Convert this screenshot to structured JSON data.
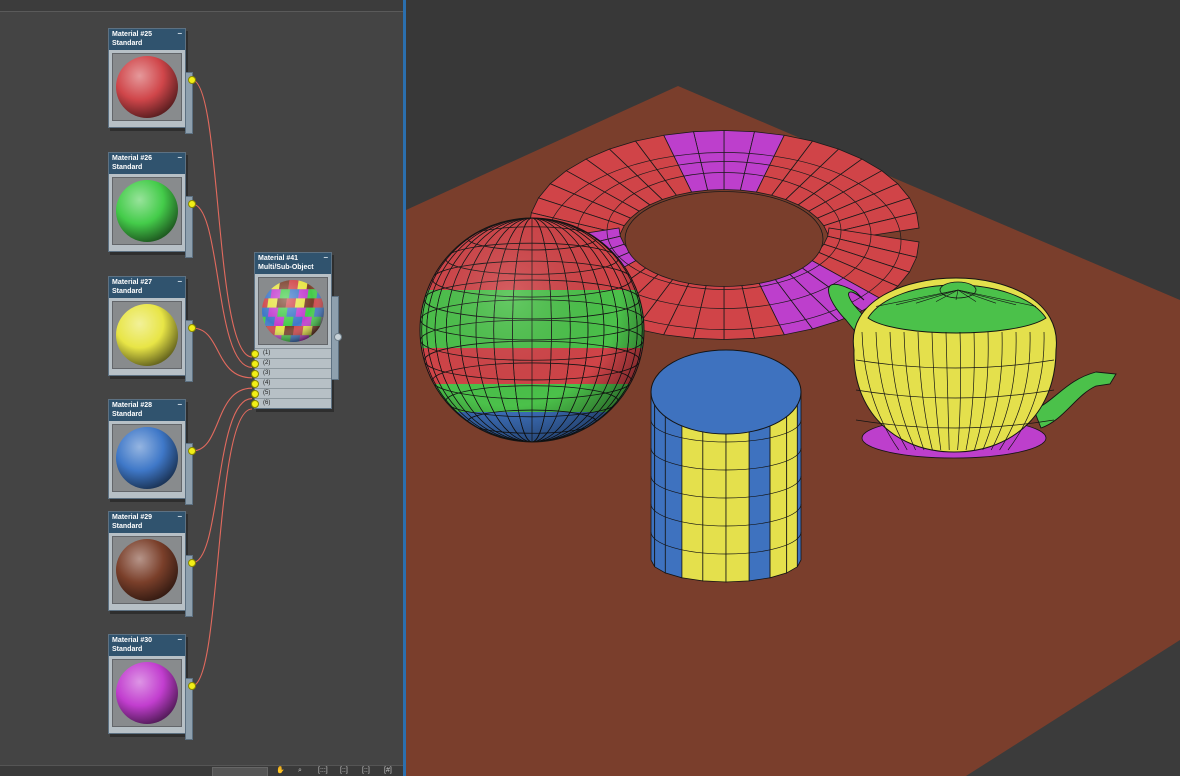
{
  "slate_editor": {
    "nodes": [
      {
        "title": "Material #25",
        "type": "Standard",
        "color": "#d0464a"
      },
      {
        "title": "Material #26",
        "type": "Standard",
        "color": "#44cc4a"
      },
      {
        "title": "Material #27",
        "type": "Standard",
        "color": "#e8e546"
      },
      {
        "title": "Material #28",
        "type": "Standard",
        "color": "#3f78c8"
      },
      {
        "title": "Material #29",
        "type": "Standard",
        "color": "#7a3f2a"
      },
      {
        "title": "Material #30",
        "type": "Standard",
        "color": "#c23ecf"
      }
    ],
    "multi_node": {
      "title": "Material #41",
      "type": "Multi/Sub-Object",
      "slots": [
        "(1)",
        "(2)",
        "(3)",
        "(4)",
        "(5)",
        "(6)"
      ]
    },
    "minimize_glyph": "−",
    "wire_color": "#e26a5e",
    "toolbar_glyphs": [
      "✋",
      "⌕",
      "[:::]",
      "[::]",
      "[::]",
      "[#]"
    ]
  },
  "viewport": {
    "background": "#383838",
    "ground_color": "#7a3e2c",
    "objects": [
      {
        "name": "torus",
        "colors": [
          "#d04448",
          "#bd3fcc"
        ]
      },
      {
        "name": "sphere",
        "colors": [
          "#d04448",
          "#4bc14a",
          "#3e72bf"
        ]
      },
      {
        "name": "cylinder",
        "colors": [
          "#3e72bf",
          "#e4e04c"
        ]
      },
      {
        "name": "teapot",
        "colors": [
          "#e4e04c",
          "#4bc14a",
          "#bd3fcc"
        ]
      }
    ]
  }
}
